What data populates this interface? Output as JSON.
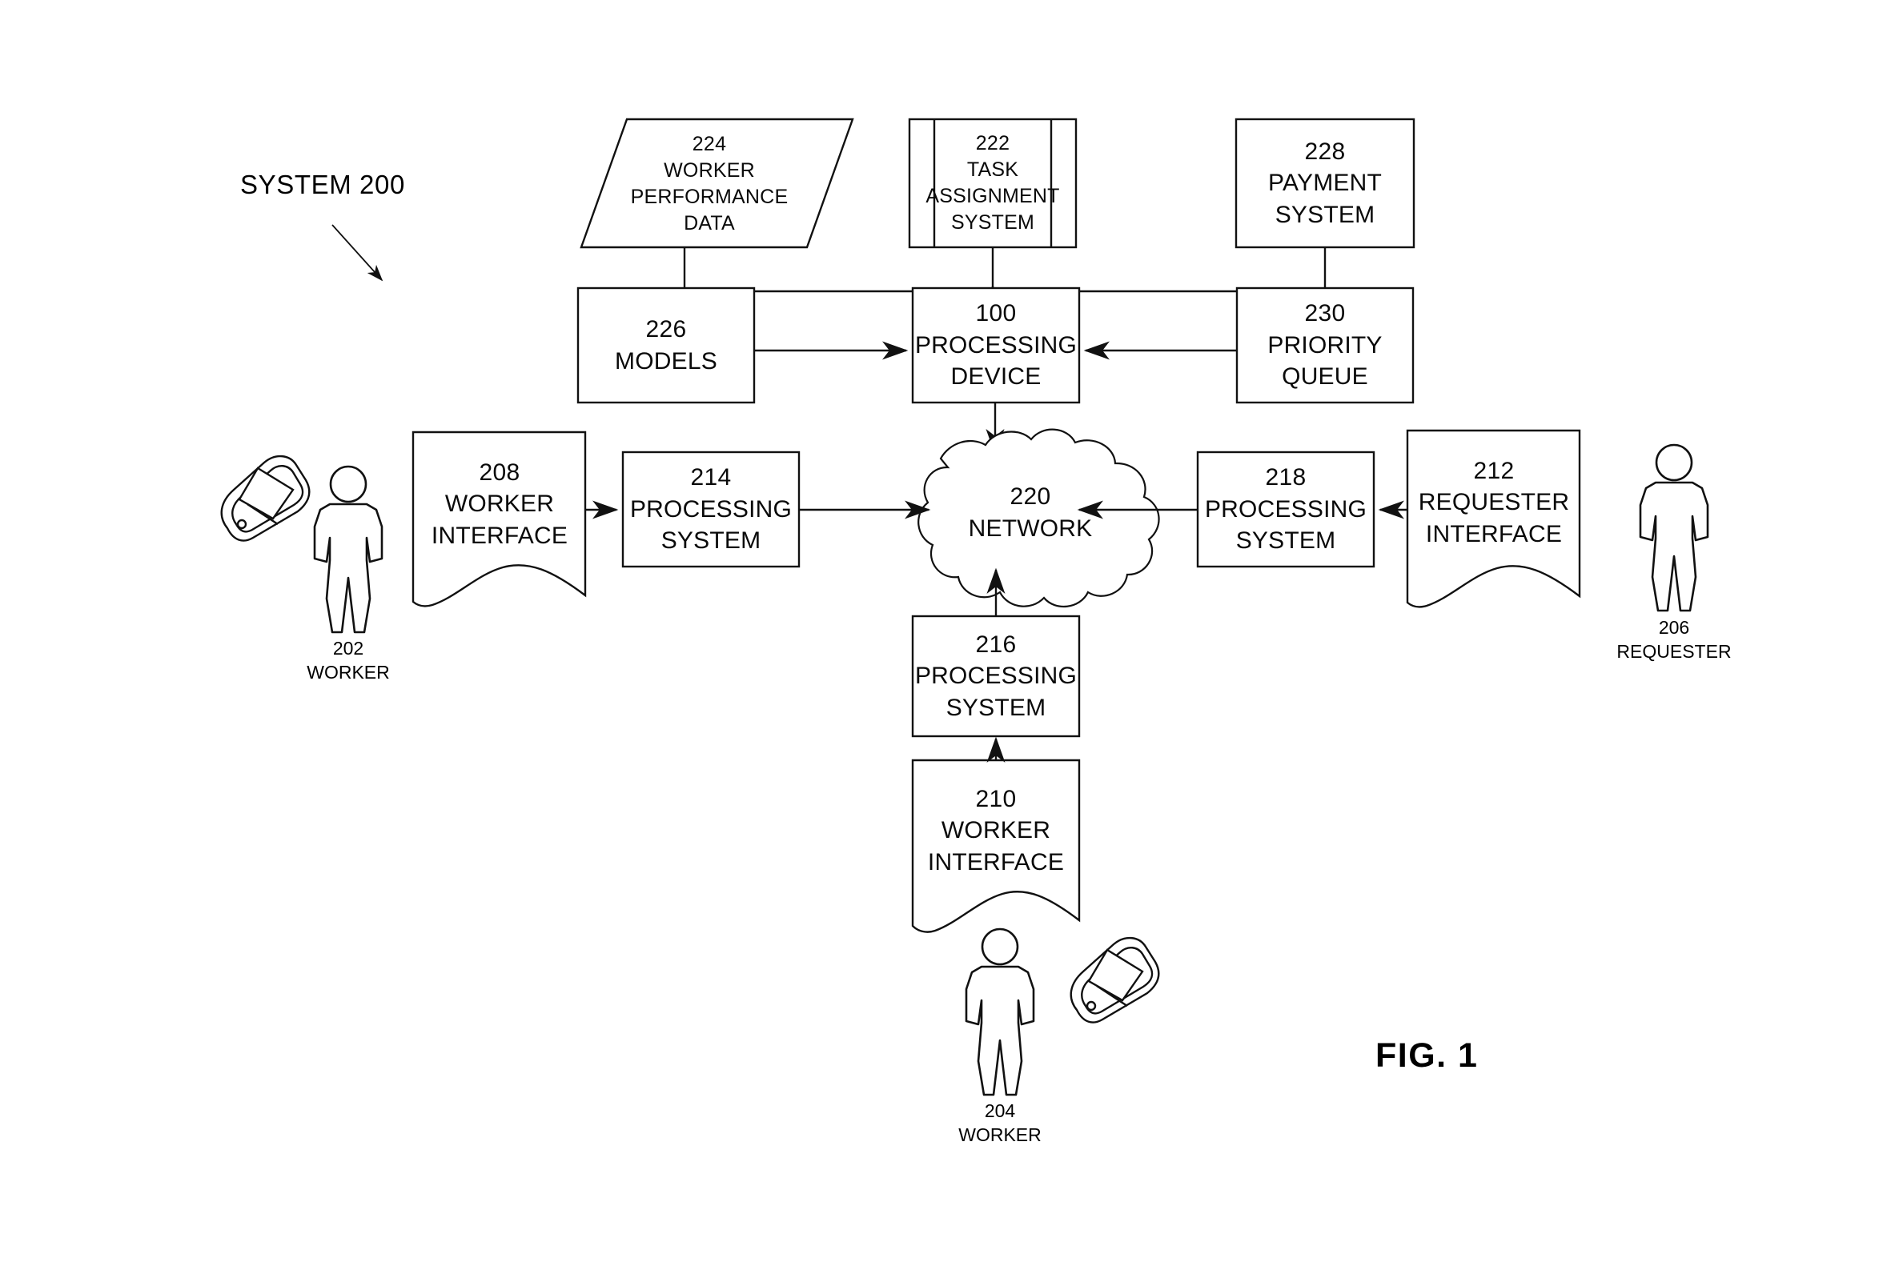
{
  "figure": {
    "caption": "FIG. 1",
    "system_title": "SYSTEM 200"
  },
  "nodes": {
    "n224": {
      "ref": "224",
      "line1": "WORKER",
      "line2": "PERFORMANCE",
      "line3": "DATA",
      "shape": "parallelogram-data-store"
    },
    "n222": {
      "ref": "222",
      "line1": "TASK",
      "line2": "ASSIGNMENT",
      "line3": "SYSTEM",
      "shape": "predefined-process"
    },
    "n228": {
      "ref": "228",
      "line1": "PAYMENT",
      "line2": "SYSTEM",
      "shape": "rectangle"
    },
    "n226": {
      "ref": "226",
      "line1": "MODELS",
      "shape": "rectangle"
    },
    "n100": {
      "ref": "100",
      "line1": "PROCESSING",
      "line2": "DEVICE",
      "shape": "rectangle"
    },
    "n230": {
      "ref": "230",
      "line1": "PRIORITY",
      "line2": "QUEUE",
      "shape": "rectangle"
    },
    "n208": {
      "ref": "208",
      "line1": "WORKER",
      "line2": "INTERFACE",
      "shape": "document"
    },
    "n214": {
      "ref": "214",
      "line1": "PROCESSING",
      "line2": "SYSTEM",
      "shape": "rectangle"
    },
    "n220": {
      "ref": "220",
      "line1": "NETWORK",
      "shape": "cloud"
    },
    "n218": {
      "ref": "218",
      "line1": "PROCESSING",
      "line2": "SYSTEM",
      "shape": "rectangle"
    },
    "n212": {
      "ref": "212",
      "line1": "REQUESTER",
      "line2": "INTERFACE",
      "shape": "document"
    },
    "n216": {
      "ref": "216",
      "line1": "PROCESSING",
      "line2": "SYSTEM",
      "shape": "rectangle"
    },
    "n210": {
      "ref": "210",
      "line1": "WORKER",
      "line2": "INTERFACE",
      "shape": "document"
    }
  },
  "actors": {
    "a202": {
      "ref": "202",
      "name": "WORKER",
      "icon": "person-icon",
      "device_icon": "mobile-phone-icon"
    },
    "a204": {
      "ref": "204",
      "name": "WORKER",
      "icon": "person-icon",
      "device_icon": "mobile-phone-icon"
    },
    "a206": {
      "ref": "206",
      "name": "REQUESTER",
      "icon": "person-icon"
    }
  },
  "colors": {
    "stroke": "#111111",
    "fill": "#ffffff",
    "background": "#ffffff"
  }
}
